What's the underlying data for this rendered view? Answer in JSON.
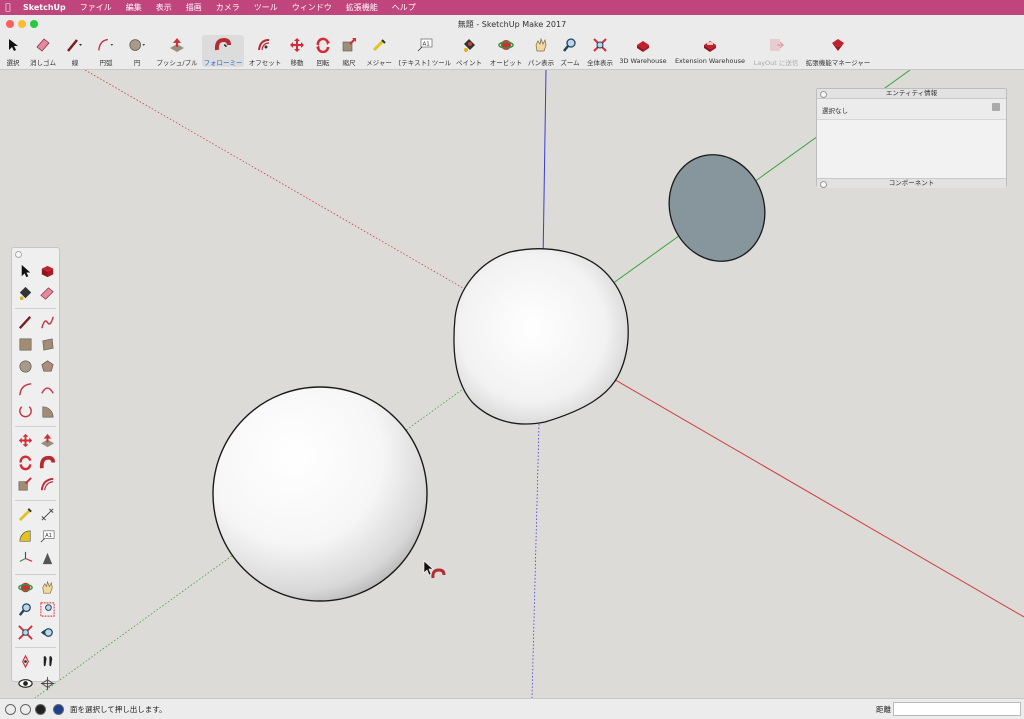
{
  "menubar": {
    "app": "SketchUp",
    "items": [
      "ファイル",
      "編集",
      "表示",
      "描画",
      "カメラ",
      "ツール",
      "ウィンドウ",
      "拡張機能",
      "ヘルプ"
    ]
  },
  "window": {
    "title": "無題 - SketchUp Make 2017"
  },
  "toolbar": {
    "items": [
      {
        "label": "選択",
        "icon": "arrow-select-icon"
      },
      {
        "label": "消しゴム",
        "icon": "eraser-icon"
      },
      {
        "label": "線",
        "icon": "pencil-line-icon"
      },
      {
        "label": "円弧",
        "icon": "arc-icon"
      },
      {
        "label": "円",
        "icon": "circle-icon"
      },
      {
        "label": "プッシュ/プル",
        "icon": "push-pull-icon"
      },
      {
        "label": "フォローミー",
        "icon": "follow-me-icon",
        "active": true
      },
      {
        "label": "オフセット",
        "icon": "offset-icon"
      },
      {
        "label": "移動",
        "icon": "move-icon"
      },
      {
        "label": "回転",
        "icon": "rotate-icon"
      },
      {
        "label": "縮尺",
        "icon": "scale-icon"
      },
      {
        "label": "メジャー",
        "icon": "tape-measure-icon"
      },
      {
        "label": "[テキスト] ツール",
        "icon": "text-icon"
      },
      {
        "label": "ペイント",
        "icon": "paint-bucket-icon"
      },
      {
        "label": "オービット",
        "icon": "orbit-icon"
      },
      {
        "label": "パン表示",
        "icon": "pan-hand-icon"
      },
      {
        "label": "ズーム",
        "icon": "zoom-icon"
      },
      {
        "label": "全体表示",
        "icon": "zoom-extents-icon"
      },
      {
        "label": "3D Warehouse",
        "icon": "warehouse-icon"
      },
      {
        "label": "Extension Warehouse",
        "icon": "extension-warehouse-icon"
      },
      {
        "label": "LayOut に送信",
        "icon": "layout-icon",
        "disabled": true
      },
      {
        "label": "拡張機能マネージャー",
        "icon": "extension-manager-icon"
      }
    ]
  },
  "entity_panel": {
    "title": "エンティティ情報",
    "selection": "選択なし",
    "footer": "コンポーネント"
  },
  "palette": {
    "icons": [
      "select-icon",
      "component-icon",
      "paint-icon",
      "eraser-icon",
      "line-icon",
      "freehand-icon",
      "rectangle-icon",
      "rotated-rectangle-icon",
      "circle-icon",
      "polygon-icon",
      "arc-icon",
      "two-point-arc-icon",
      "three-point-arc-icon",
      "pie-icon",
      "move-icon",
      "push-pull-icon",
      "rotate-icon",
      "follow-me-icon",
      "scale-icon",
      "offset-icon",
      "tape-measure-icon",
      "dimension-icon",
      "protractor-icon",
      "text-icon",
      "axes-icon",
      "3d-text-icon",
      "orbit-icon",
      "pan-icon",
      "zoom-icon",
      "zoom-window-icon",
      "zoom-extents-icon",
      "previous-view-icon",
      "position-camera-icon",
      "walk-icon",
      "look-around-icon",
      "section-plane-icon"
    ]
  },
  "statusbar": {
    "message": "面を選択して押し出します。",
    "distance_label": "距離",
    "distance_value": ""
  },
  "colors": {
    "menubar": "#c0457c",
    "axis_red": "#d23b3b",
    "axis_green": "#3aa43a",
    "axis_blue": "#3c3cd6",
    "disc_fill": "#86969c",
    "viewport_bg": "#dcdbd7"
  }
}
